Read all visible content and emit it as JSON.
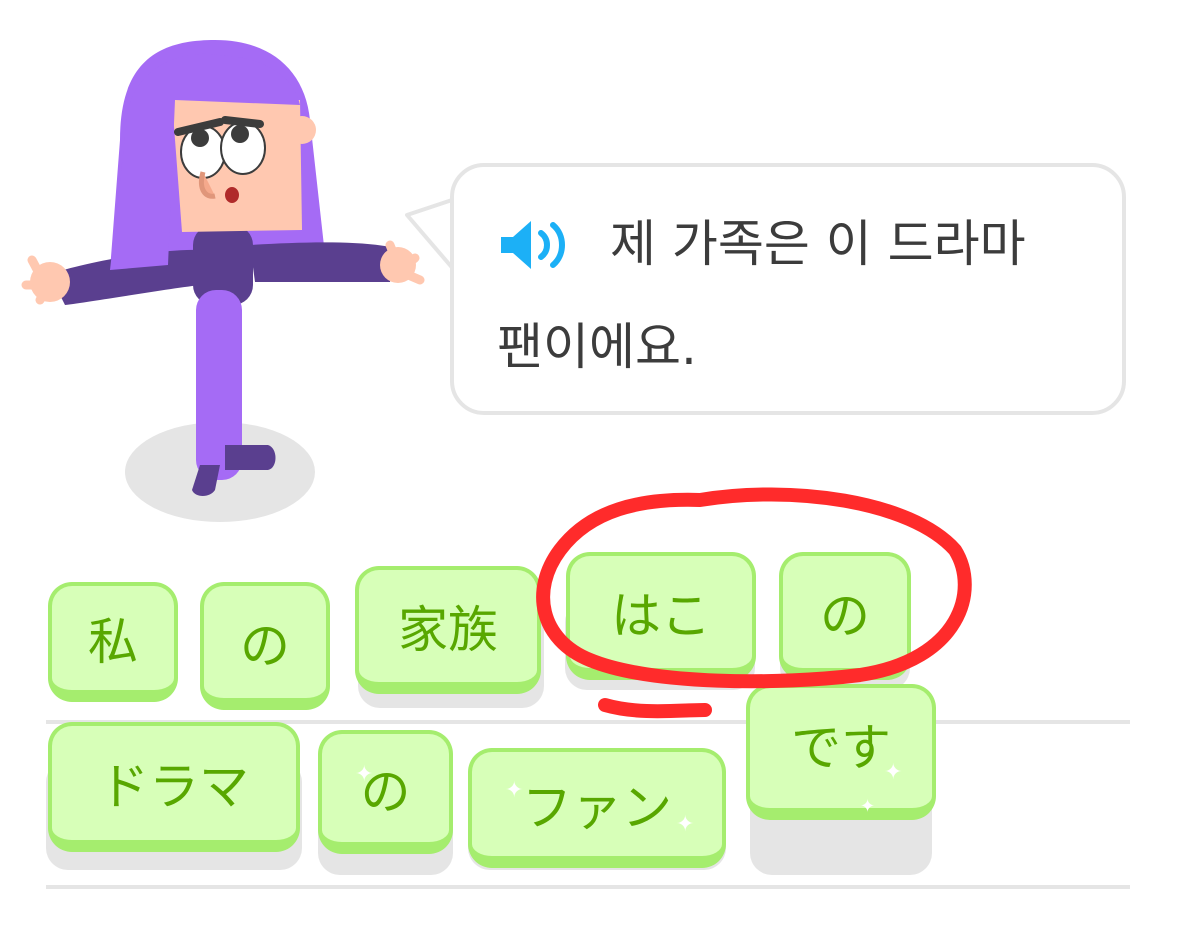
{
  "prompt": {
    "speaker_icon": "speaker-icon",
    "line1": "제 가족은 이 드라마",
    "line2": "팬이에요."
  },
  "answer_row": [
    {
      "label": "私"
    },
    {
      "label": "の"
    },
    {
      "label": "家族"
    },
    {
      "label": "はこ"
    },
    {
      "label": "の"
    }
  ],
  "answer_row2": [
    {
      "label": "ドラマ"
    },
    {
      "label": "の"
    },
    {
      "label": "ファン"
    },
    {
      "label": "です"
    }
  ],
  "colors": {
    "tile_fill": "#d7ffb8",
    "tile_border": "#a5ed6e",
    "tile_text": "#58a700",
    "speaker_blue": "#1cb0f6",
    "annotation_red": "#ff2b2b",
    "character_purple": "#a56bf5"
  }
}
